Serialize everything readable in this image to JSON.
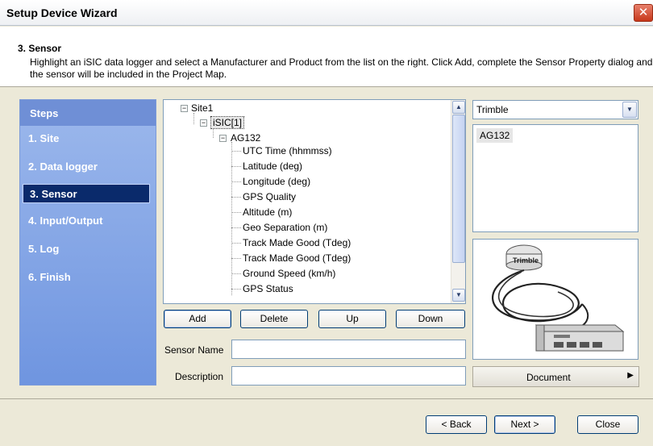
{
  "window": {
    "title": "Setup Device Wizard",
    "close_glyph": "✕"
  },
  "header": {
    "step_title": "3. Sensor",
    "description": "Highlight an iSIC data logger and select a Manufacturer and Product from the list on the right. Click Add, complete the Sensor Property dialog and the sensor will be included in the Project Map."
  },
  "steps": {
    "title": "Steps",
    "items": [
      {
        "label": "1. Site"
      },
      {
        "label": "2. Data logger"
      },
      {
        "label": "3. Sensor",
        "active": true
      },
      {
        "label": "4. Input/Output"
      },
      {
        "label": "5. Log"
      },
      {
        "label": "6. Finish"
      }
    ]
  },
  "tree": {
    "root": "Site1",
    "logger": "iSIC[1]",
    "device": "AG132",
    "fields": [
      "UTC Time (hhmmss)",
      "Latitude (deg)",
      "Longitude (deg)",
      "GPS Quality",
      "Altitude (m)",
      "Geo Separation (m)",
      "Track Made Good (Tdeg)",
      "Track Made Good (Tdeg)",
      "Ground Speed (km/h)",
      "GPS Status"
    ]
  },
  "buttons": {
    "add": "Add",
    "delete": "Delete",
    "up": "Up",
    "down": "Down",
    "back": "< Back",
    "next": "Next >",
    "close": "Close"
  },
  "form": {
    "sensor_name_label": "Sensor Name",
    "sensor_name_value": "",
    "description_label": "Description",
    "description_value": ""
  },
  "manufacturer": {
    "selected": "Trimble"
  },
  "products": [
    "AG132"
  ],
  "image_brand": "Trimble",
  "document_button": "Document",
  "colors": {
    "steps_panel": "#7d9fe3",
    "active_step": "#0a2a6b",
    "button_border": "#003c74"
  }
}
